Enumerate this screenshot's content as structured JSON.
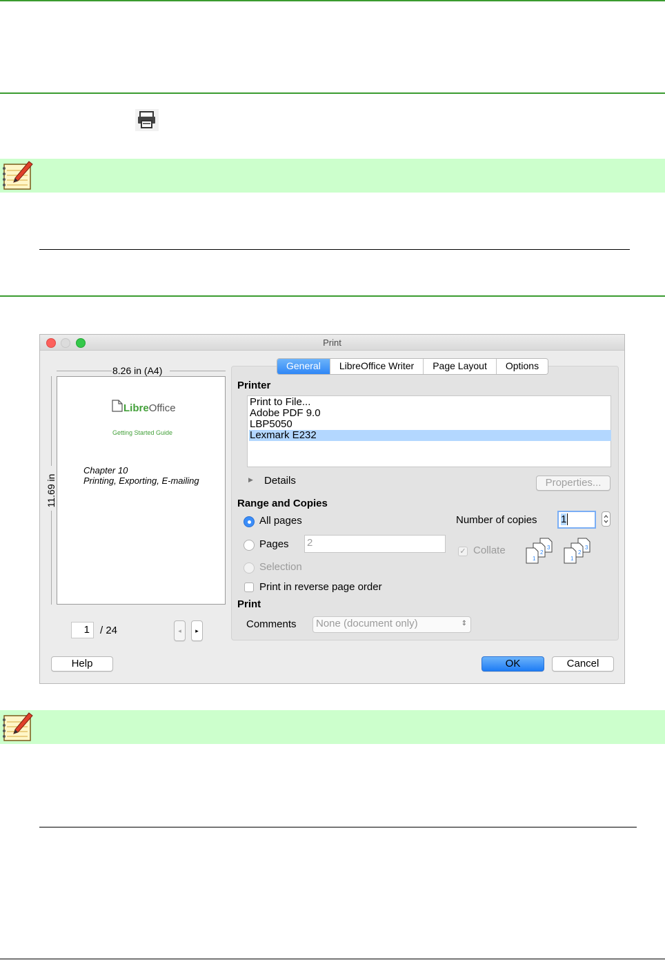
{
  "dialog": {
    "title": "Print",
    "tabs": [
      {
        "label": "General"
      },
      {
        "label": "LibreOffice Writer"
      },
      {
        "label": "Page Layout"
      },
      {
        "label": "Options"
      }
    ],
    "preview": {
      "width_label": "8.26 in (A4)",
      "height_label": "11.69 in",
      "logo_text_a": "Libre",
      "logo_text_b": "Office",
      "guide_title": "Getting Started Guide",
      "chapter": "Chapter 10",
      "chapter_title": "Printing, Exporting, E-mailing",
      "current_page": "1",
      "total_pages": "/ 24"
    },
    "printer": {
      "section_label": "Printer",
      "items": [
        "Print to File...",
        "Adobe PDF 9.0",
        "LBP5050",
        "Lexmark E232"
      ],
      "selected": "Lexmark E232",
      "details_label": "Details",
      "properties_label": "Properties..."
    },
    "range": {
      "section_label": "Range and Copies",
      "all_pages_label": "All pages",
      "pages_label": "Pages",
      "pages_value": "2",
      "selection_label": "Selection",
      "reverse_label": "Print in reverse page order",
      "copies_label": "Number of copies",
      "copies_value": "1",
      "collate_label": "Collate"
    },
    "print": {
      "section_label": "Print",
      "comments_label": "Comments",
      "comments_value": "None (document only)"
    },
    "buttons": {
      "help": "Help",
      "ok": "OK",
      "cancel": "Cancel"
    }
  },
  "colors": {
    "rule_green": "#3a9b2f",
    "note_band": "#ccffcc",
    "accent_blue": "#2f87f6",
    "selection_blue": "#b3d7ff"
  },
  "icons": [
    "printer-icon",
    "note-icon",
    "collate-icon"
  ]
}
